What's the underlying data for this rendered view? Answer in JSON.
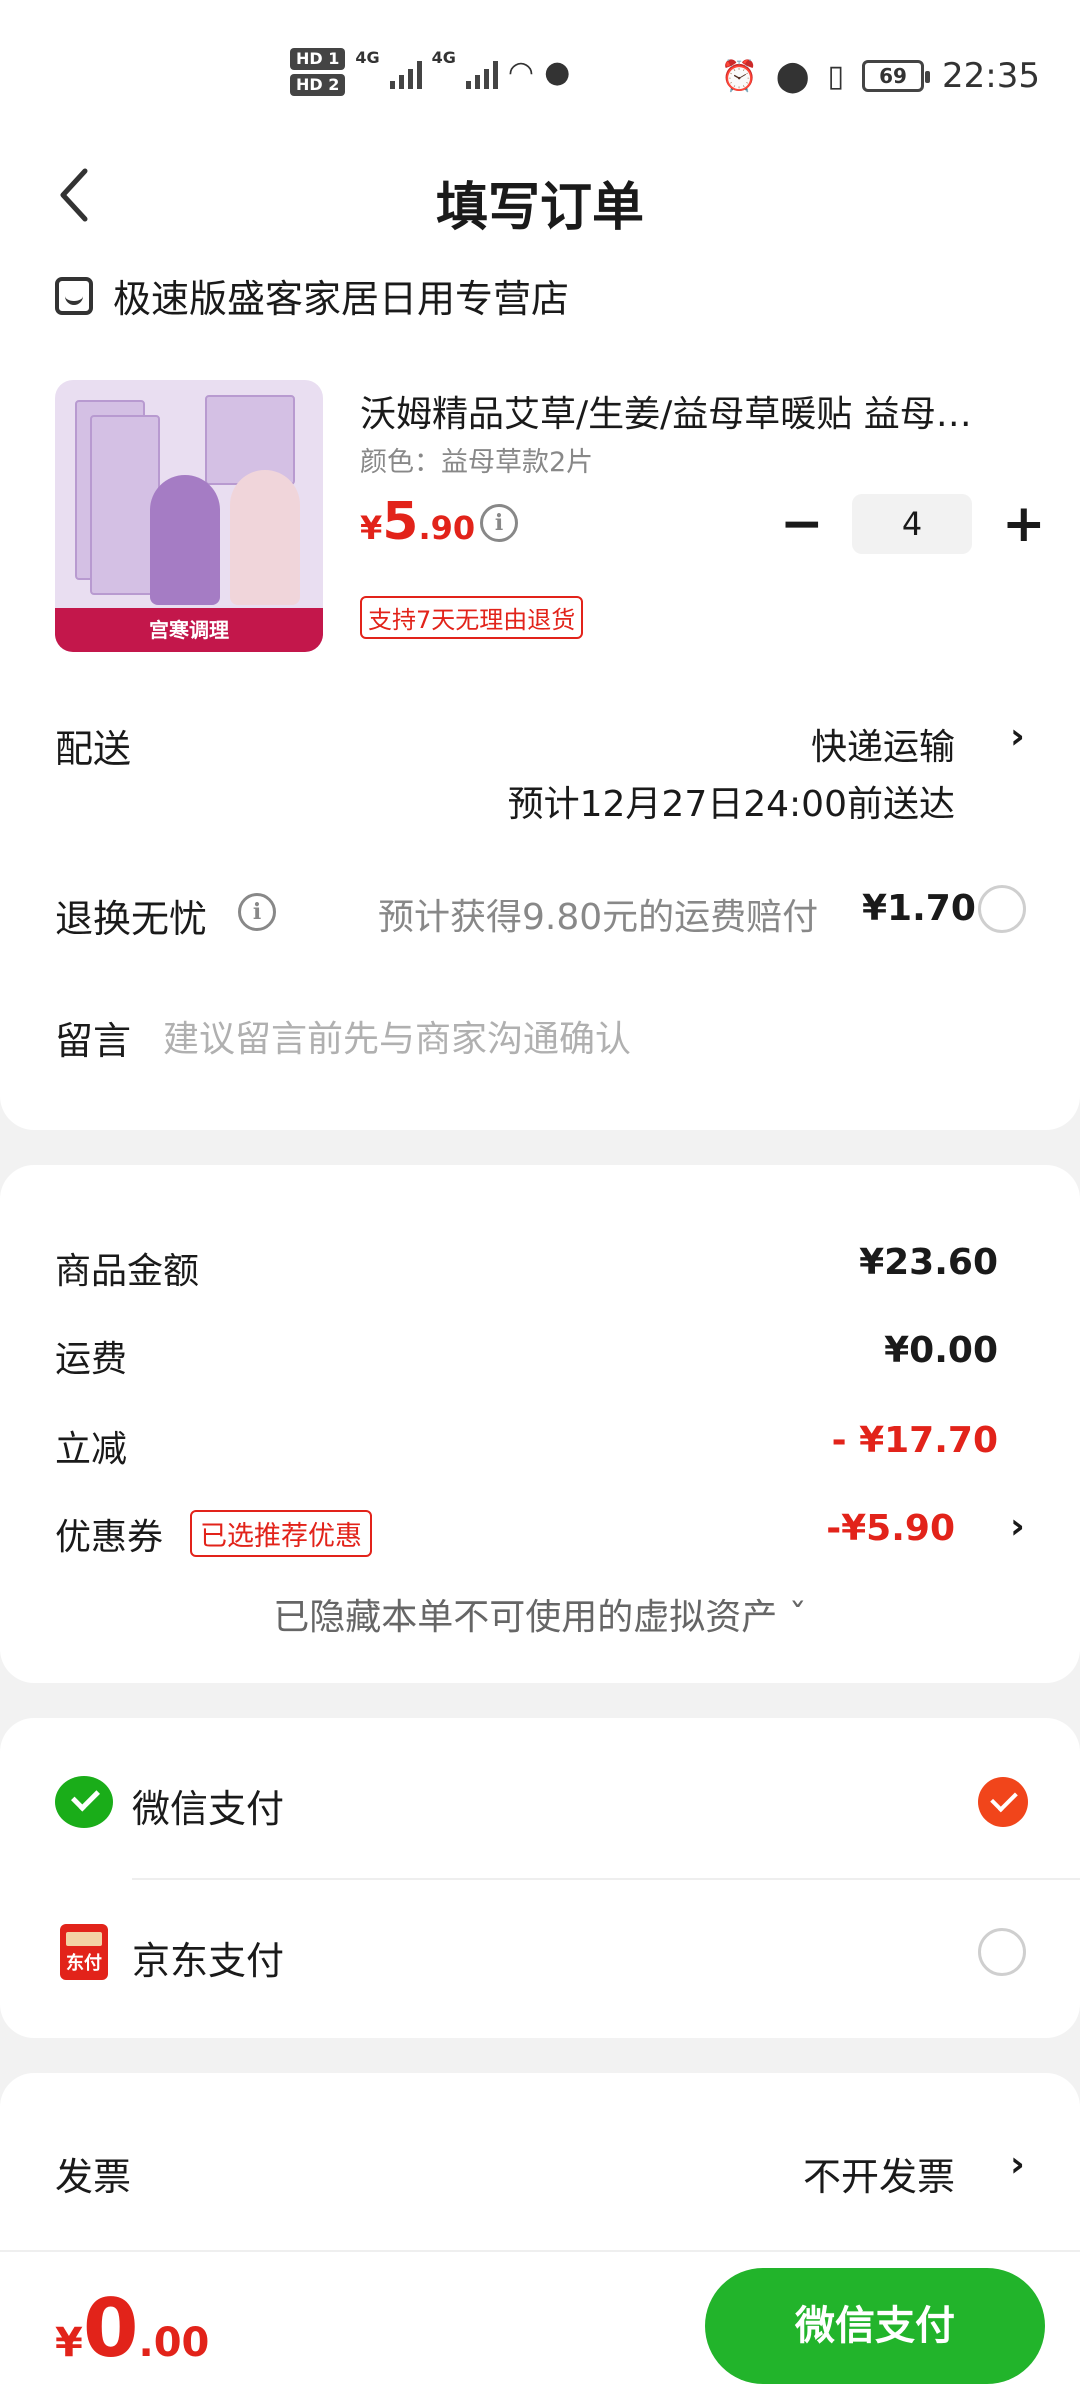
{
  "status_bar": {
    "hd1": "HD 1",
    "hd2": "HD 2",
    "net1": "4G",
    "net2": "4G",
    "battery": "69",
    "time": "22:35"
  },
  "header": {
    "title": "填写订单"
  },
  "shop": {
    "name": "极速版盛客家居日用专营店"
  },
  "product": {
    "name": "沃姆精品艾草/生姜/益母草暖贴 益母…",
    "spec": "颜色：益母草款2片",
    "price_currency": "¥",
    "price_int": "5",
    "price_dec": ".90",
    "quantity": "4",
    "qty_minus": "−",
    "qty_plus": "+",
    "return_tag": "支持7天无理由退货",
    "image_banner": "宫寒调理"
  },
  "delivery": {
    "label": "配送",
    "method": "快递运输",
    "estimate": "预计12月27日24:00前送达"
  },
  "worry_free": {
    "label": "退换无忧",
    "text": "预计获得9.80元的运费赔付",
    "price": "¥1.70"
  },
  "message": {
    "label": "留言",
    "placeholder": "建议留言前先与商家沟通确认"
  },
  "amounts": {
    "goods_label": "商品金额",
    "goods_value": "¥23.60",
    "shipping_label": "运费",
    "shipping_value": "¥0.00",
    "discount_label": "立减",
    "discount_value": "- ¥17.70",
    "coupon_label": "优惠券",
    "coupon_tag": "已选推荐优惠",
    "coupon_value": "-¥5.90",
    "hidden_assets": "已隐藏本单不可使用的虚拟资产 ˇ"
  },
  "payment": {
    "wechat_label": "微信支付",
    "jd_label": "京东支付",
    "jd_icon_text": "东付"
  },
  "invoice": {
    "label": "发票",
    "value": "不开发票"
  },
  "bottom": {
    "total_currency": "¥",
    "total_int": "0",
    "total_dec": ".00",
    "pay_button": "微信支付"
  },
  "colors": {
    "accent_red": "#e2231a",
    "wechat_green": "#22b42b",
    "check_orange": "#f1451b"
  }
}
